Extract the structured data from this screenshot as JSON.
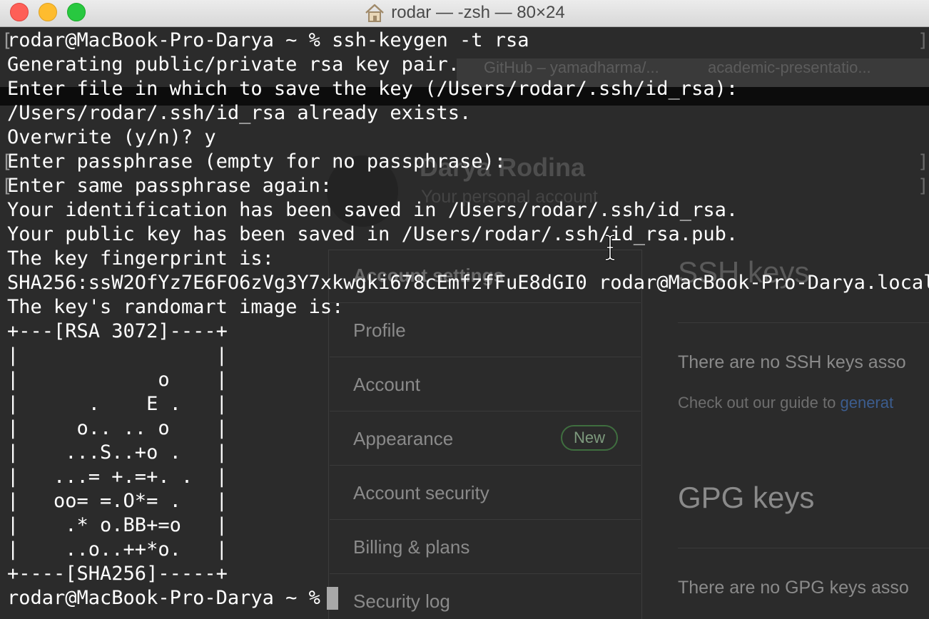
{
  "window": {
    "title": "rodar — -zsh — 80×24",
    "buttons": {
      "close": "close",
      "minimize": "minimize",
      "zoom": "zoom"
    }
  },
  "background": {
    "tabs": [
      "GitHub – yamadharma/...",
      "academic-presentatio..."
    ],
    "profile_name": "Darya Rodina",
    "profile_subtitle": "Your personal account",
    "menu_header": "Account settings",
    "menu_items": [
      "Profile",
      "Account",
      "Appearance",
      "Account security",
      "Billing & plans",
      "Security log"
    ],
    "new_badge": "New",
    "ssh_heading": "SSH keys",
    "ssh_empty": "There are no SSH keys asso",
    "guide_prefix": "Check out our guide to ",
    "guide_link": "generat",
    "gpg_heading": "GPG keys",
    "gpg_empty": "There are no GPG keys asso"
  },
  "terminal": {
    "lines": [
      "rodar@MacBook-Pro-Darya ~ % ssh-keygen -t rsa",
      "Generating public/private rsa key pair.",
      "Enter file in which to save the key (/Users/rodar/.ssh/id_rsa):",
      "/Users/rodar/.ssh/id_rsa already exists.",
      "Overwrite (y/n)? y",
      "Enter passphrase (empty for no passphrase):",
      "Enter same passphrase again:",
      "Your identification has been saved in /Users/rodar/.ssh/id_rsa.",
      "Your public key has been saved in /Users/rodar/.ssh/id_rsa.pub.",
      "The key fingerprint is:",
      "SHA256:ssW2OfYz7E6FO6zVg3Y7xkwgki678cEmfzfFuE8dGI0 rodar@MacBook-Pro-Darya.local",
      "The key's randomart image is:",
      "+---[RSA 3072]----+",
      "|                 |",
      "|            o    |",
      "|      .    E .   |",
      "|     o.. .. o    |",
      "|    ...S..+o .   |",
      "|   ...= +.=+. .  |",
      "|   oo= =.O*= .   |",
      "|    .* o.BB+=o   |",
      "|    ..o..++*o.   |",
      "+----[SHA256]-----+",
      "rodar@MacBook-Pro-Darya ~ % "
    ]
  }
}
